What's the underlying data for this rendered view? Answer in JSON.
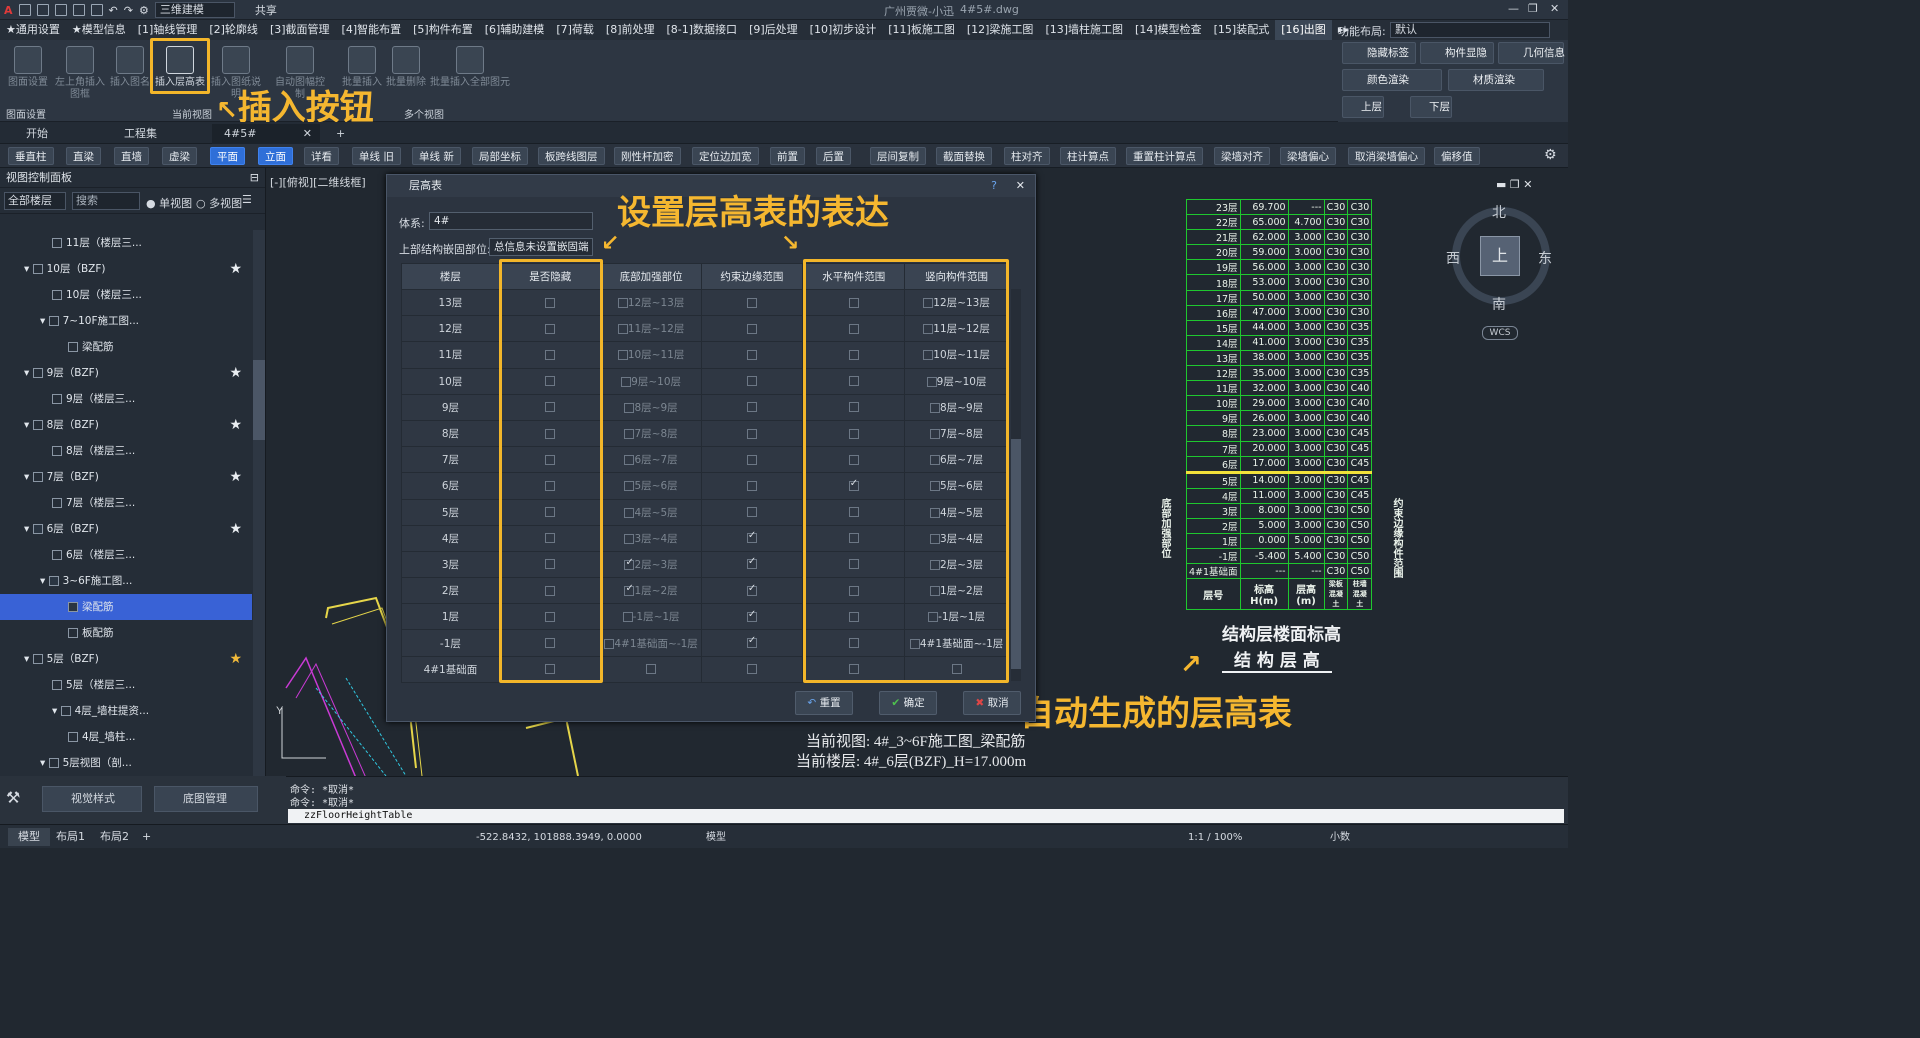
{
  "titlebar": {
    "center": "广州贾微-小迅",
    "file": "4#5#.dwg",
    "workspace": "三维建模",
    "share": "共享"
  },
  "menu": [
    "★通用设置",
    "★模型信息",
    "[1]轴线管理",
    "[2]轮廓线",
    "[3]截面管理",
    "[4]智能布置",
    "[5]构件布置",
    "[6]辅助建模",
    "[7]荷载",
    "[8]前处理",
    "[8-1]数据接口",
    "[9]后处理",
    "[10]初步设计",
    "[11]板施工图",
    "[12]梁施工图",
    "[13]墙柱施工图",
    "[14]模型检查",
    "[15]装配式",
    "[16]出图"
  ],
  "function_layout": {
    "label": "功能布局:",
    "value": "默认"
  },
  "ribbon": {
    "buttons": [
      "图面设置",
      "左上角插入图框",
      "插入图名",
      "插入层高表",
      "插入图纸说明",
      "自动图幅控制",
      "批量插入",
      "批量删除",
      "批量插入全部图元"
    ],
    "groups": [
      "图面设置",
      "当前视图",
      "多个视图"
    ]
  },
  "right_panel": [
    "隐藏标签",
    "构件显隐",
    "几何信息",
    "颜色渲染",
    "材质渲染",
    "上层",
    "下层"
  ],
  "tabs": [
    "开始",
    "工程集",
    "4#5#"
  ],
  "toolbar2": [
    "垂直柱",
    "直梁",
    "直墙",
    "虚梁",
    "平面",
    "立面",
    "详看",
    "单线 旧",
    "单线 新",
    "局部坐标",
    "板跨线图层",
    "刚性杆加密",
    "定位边加宽",
    "前置",
    "后置",
    "层间复制",
    "截面替换",
    "柱对齐",
    "柱计算点",
    "重置柱计算点",
    "梁墙对齐",
    "梁墙偏心",
    "取消梁墙偏心",
    "偏移值"
  ],
  "left_panel": {
    "title": "视图控制面板",
    "filter": "全部楼层",
    "search": "搜索",
    "single": "单视图",
    "multi": "多视图",
    "tree": [
      "11层（楼层三...",
      "10层（BZF)",
      "10层（楼层三...",
      "7~10F施工图...",
      "梁配筋",
      "9层（BZF)",
      "9层（楼层三...",
      "8层（BZF)",
      "8层（楼层三...",
      "7层（BZF)",
      "7层（楼层三...",
      "6层（BZF)",
      "6层（楼层三...",
      "3~6F施工图...",
      "梁配筋",
      "板配筋",
      "5层（BZF)",
      "5层（楼层三...",
      "4层_墙柱提资...",
      "4层_墙柱...",
      "5层视图（剖..."
    ]
  },
  "view_label": "[-][俯视][二维线框]",
  "dialog": {
    "title": "层高表",
    "system_label": "体系:",
    "system_value": "4#",
    "embed_label": "上部结构嵌固部位:",
    "embed_value": "总信息未设置嵌固端",
    "headers": [
      "楼层",
      "是否隐藏",
      "底部加强部位",
      "约束边缘范围",
      "水平构件范围",
      "竖向构件范围"
    ],
    "rows": [
      {
        "floor": "13层",
        "range": "12层~13层",
        "c": false,
        "h": false
      },
      {
        "floor": "12层",
        "range": "11层~12层",
        "c": false,
        "h": false
      },
      {
        "floor": "11层",
        "range": "10层~11层",
        "c": false,
        "h": false
      },
      {
        "floor": "10层",
        "range": "9层~10层",
        "c": false,
        "h": false
      },
      {
        "floor": "9层",
        "range": "8层~9层",
        "c": false,
        "h": false
      },
      {
        "floor": "8层",
        "range": "7层~8层",
        "c": false,
        "h": false
      },
      {
        "floor": "7层",
        "range": "6层~7层",
        "c": false,
        "h": false
      },
      {
        "floor": "6层",
        "range": "5层~6层",
        "c": false,
        "h": true
      },
      {
        "floor": "5层",
        "range": "4层~5层",
        "c": false,
        "h": false
      },
      {
        "floor": "4层",
        "range": "3层~4层",
        "c": true,
        "h": false
      },
      {
        "floor": "3层",
        "range": "2层~3层",
        "c": true,
        "h": false,
        "b": true
      },
      {
        "floor": "2层",
        "range": "1层~2层",
        "c": true,
        "h": false,
        "b": true
      },
      {
        "floor": "1层",
        "range": "-1层~1层",
        "c": true,
        "h": false
      },
      {
        "floor": "-1层",
        "range": "4#1基础面~-1层",
        "c": true,
        "h": false
      },
      {
        "floor": "4#1基础面",
        "range": "",
        "c": false,
        "h": false
      }
    ],
    "reset": "重置",
    "ok": "确定",
    "cancel": "取消"
  },
  "annotations": {
    "insert": "插入按钮",
    "setting": "设置层高表的表达",
    "auto": "自动生成的层高表"
  },
  "height_table": {
    "rows": [
      [
        "23层",
        "69.700",
        "---",
        "C30",
        "C30"
      ],
      [
        "22层",
        "65.000",
        "4.700",
        "C30",
        "C30"
      ],
      [
        "21层",
        "62.000",
        "3.000",
        "C30",
        "C30"
      ],
      [
        "20层",
        "59.000",
        "3.000",
        "C30",
        "C30"
      ],
      [
        "19层",
        "56.000",
        "3.000",
        "C30",
        "C30"
      ],
      [
        "18层",
        "53.000",
        "3.000",
        "C30",
        "C30"
      ],
      [
        "17层",
        "50.000",
        "3.000",
        "C30",
        "C30"
      ],
      [
        "16层",
        "47.000",
        "3.000",
        "C30",
        "C30"
      ],
      [
        "15层",
        "44.000",
        "3.000",
        "C30",
        "C35"
      ],
      [
        "14层",
        "41.000",
        "3.000",
        "C30",
        "C35"
      ],
      [
        "13层",
        "38.000",
        "3.000",
        "C30",
        "C35"
      ],
      [
        "12层",
        "35.000",
        "3.000",
        "C30",
        "C35"
      ],
      [
        "11层",
        "32.000",
        "3.000",
        "C30",
        "C40"
      ],
      [
        "10层",
        "29.000",
        "3.000",
        "C30",
        "C40"
      ],
      [
        "9层",
        "26.000",
        "3.000",
        "C30",
        "C40"
      ],
      [
        "8层",
        "23.000",
        "3.000",
        "C30",
        "C45"
      ],
      [
        "7层",
        "20.000",
        "3.000",
        "C30",
        "C45"
      ],
      [
        "6层",
        "17.000",
        "3.000",
        "C30",
        "C45"
      ],
      [
        "5层",
        "14.000",
        "3.000",
        "C30",
        "C45"
      ],
      [
        "4层",
        "11.000",
        "3.000",
        "C30",
        "C45"
      ],
      [
        "3层",
        "8.000",
        "3.000",
        "C30",
        "C50"
      ],
      [
        "2层",
        "5.000",
        "3.000",
        "C30",
        "C50"
      ],
      [
        "1层",
        "0.000",
        "5.000",
        "C30",
        "C50"
      ],
      [
        "-1层",
        "-5.400",
        "5.400",
        "C30",
        "C50"
      ],
      [
        "4#1基础面",
        "---",
        "---",
        "C30",
        "C50"
      ]
    ],
    "foot": [
      "层号",
      "标高H(m)",
      "层高(m)",
      "梁板混凝土",
      "柱墙混凝土"
    ],
    "side_left": "底部加强部位",
    "side_right": "约束边缘构件范围",
    "caption1": "结构层楼面标高",
    "caption2": "结 构 层 高"
  },
  "drawing_info": {
    "view": "当前视图:  4#_3~6F施工图_梁配筋",
    "floor": "当前楼层:  4#_6层(BZF)_H=17.000m"
  },
  "compass": {
    "n": "北",
    "s": "南",
    "e": "东",
    "w": "西",
    "top": "上",
    "wcs": "WCS"
  },
  "cmd": {
    "l1": "命令: *取消*",
    "l2": "命令: *取消*",
    "input": "zzFloorHeightTable"
  },
  "bottom": {
    "view_style": "视觉样式",
    "base_mgmt": "底图管理"
  },
  "status": {
    "layout_tabs": [
      "模型",
      "布局1",
      "布局2"
    ],
    "coords": "-522.8432, 101888.3949, 0.0000",
    "model": "模型",
    "scale": "1:1 / 100%",
    "decimal": "小数"
  }
}
